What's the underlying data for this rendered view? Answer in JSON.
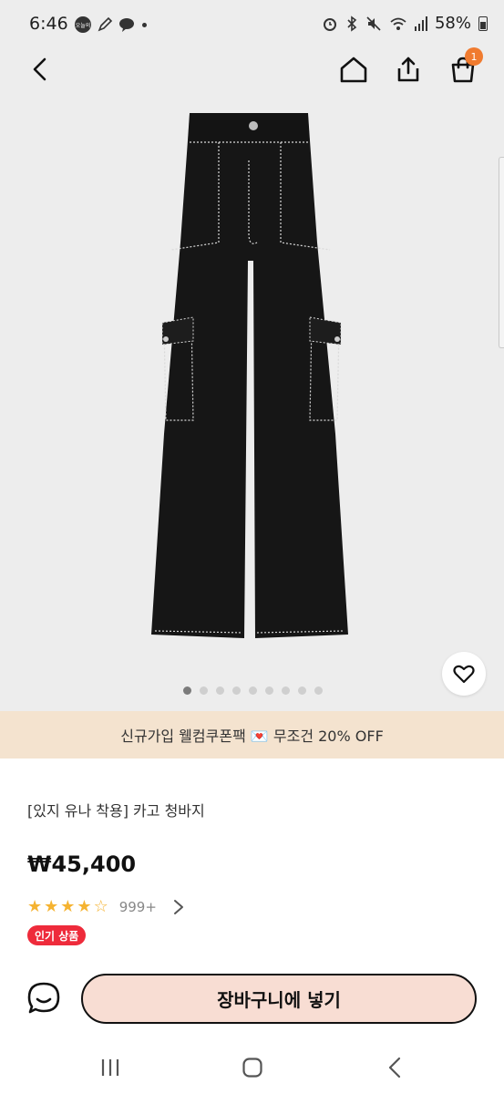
{
  "status_bar": {
    "time": "6:46",
    "notif_badge": "오늘의",
    "battery": "58%"
  },
  "header": {
    "back_icon": "back-chevron-icon",
    "home_icon": "home-icon",
    "share_icon": "share-icon",
    "cart_icon": "shopping-bag-icon",
    "cart_count": "1"
  },
  "gallery": {
    "image_description_icon": "black-cargo-pants",
    "dot_count": 9,
    "active_index": 0
  },
  "promo": {
    "text": "신규가입 웰컴쿠폰팩 💌 무조건 20% OFF"
  },
  "product": {
    "title": "[있지 유나 착용] 카고 청바지",
    "price": "₩45,400",
    "rating": 4,
    "rating_max": 5,
    "review_count": "999+",
    "badge": "인기 상품"
  },
  "actions": {
    "chat_icon": "chat-bubble-icon",
    "add_to_cart_label": "장바구니에 넣기"
  },
  "system_nav": {
    "recents_icon": "recents-icon",
    "home_icon": "home-circle-icon",
    "back_icon": "back-icon"
  },
  "colors": {
    "accent_orange": "#f07b2f",
    "promo_bg": "#f4e3cf",
    "badge_red": "#ee2b3b",
    "cart_button_bg": "#f8ddd3",
    "star": "#f5b331"
  }
}
